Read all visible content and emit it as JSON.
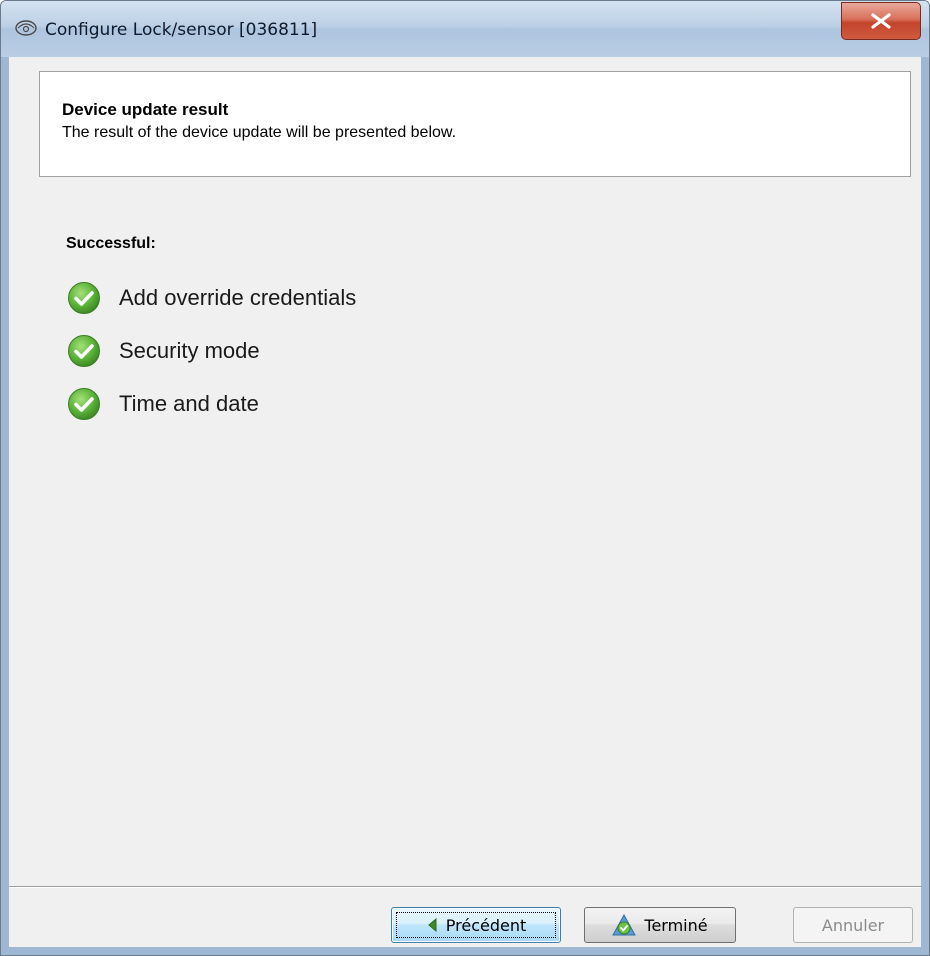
{
  "window": {
    "title": "Configure Lock/sensor [036811]",
    "close_icon": "close-x-icon",
    "app_icon": "lock-sensor-icon"
  },
  "header": {
    "title": "Device update result",
    "subtitle": "The result of the device update will be presented below."
  },
  "results": {
    "label": "Successful:",
    "items": [
      {
        "label": "Add override credentials",
        "icon": "green-check-icon"
      },
      {
        "label": "Security mode",
        "icon": "green-check-icon"
      },
      {
        "label": "Time and date",
        "icon": "green-check-icon"
      }
    ]
  },
  "buttons": {
    "previous": "Précédent",
    "finish": "Terminé",
    "cancel": "Annuler"
  },
  "colors": {
    "success_green": "#5db53a",
    "close_red": "#c4452c"
  }
}
